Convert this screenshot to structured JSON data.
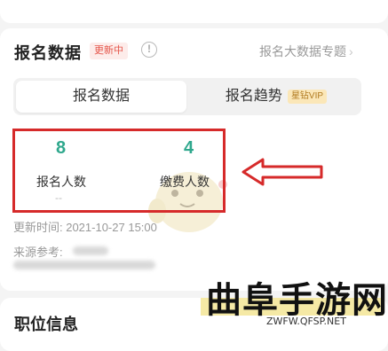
{
  "section": {
    "title": "报名数据",
    "badge": "更新中",
    "info_icon": "info-circle-icon",
    "topic_link": "报名大数据专题",
    "topic_chevron": "›"
  },
  "tabs": [
    {
      "label": "报名数据",
      "active": true
    },
    {
      "label": "报名趋势",
      "badge": "星钻VIP",
      "active": false
    }
  ],
  "stats": [
    {
      "value": "8",
      "label": "报名人数",
      "sub": "--"
    },
    {
      "value": "4",
      "label": "缴费人数"
    }
  ],
  "meta": {
    "update_time": "更新时间: 2021-10-27 15:00",
    "source": "来源参考:"
  },
  "next_section": {
    "title": "职位信息"
  },
  "watermark": {
    "text": "曲阜手游网",
    "url": "ZWFW.QFSP.NET"
  },
  "colors": {
    "accent": "#2fa88d",
    "highlight": "#d62a2a",
    "badge": "#e5574c"
  }
}
